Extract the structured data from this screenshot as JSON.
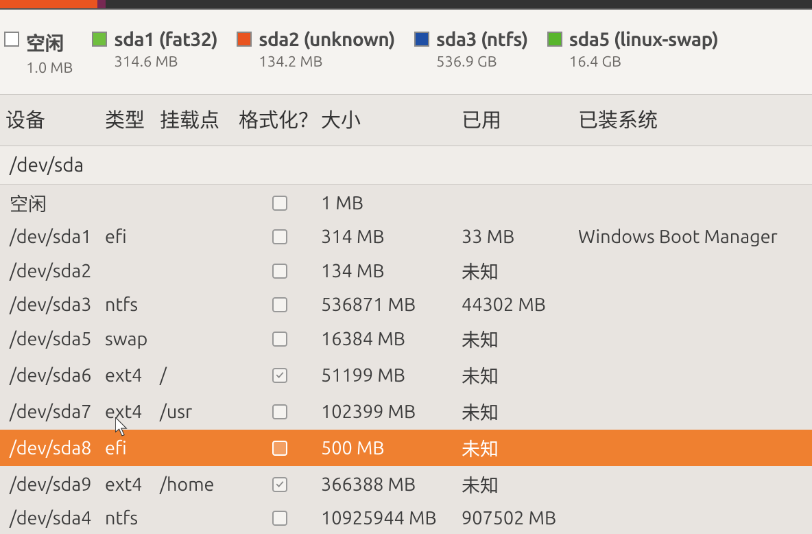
{
  "legend": {
    "free": {
      "label": "空闲",
      "size": "1.0 MB",
      "color": "#ffffff"
    },
    "items": [
      {
        "label": "sda1 (fat32)",
        "size": "314.6 MB",
        "color": "#6fbf3e"
      },
      {
        "label": "sda2 (unknown)",
        "size": "134.2 MB",
        "color": "#e95420"
      },
      {
        "label": "sda3 (ntfs)",
        "size": "536.9 GB",
        "color": "#1f4fa5"
      },
      {
        "label": "sda5 (linux-swap)",
        "size": "16.4 GB",
        "color": "#58b52c"
      }
    ]
  },
  "headers": {
    "device": "设备",
    "type": "类型",
    "mount": "挂载点",
    "format": "格式化？",
    "size": "大小",
    "used": "已用",
    "system": "已装系统"
  },
  "disk": "/dev/sda",
  "rows": [
    {
      "device": "空闲",
      "type": "",
      "mount": "",
      "format": "unchecked",
      "size": "1 MB",
      "used": "",
      "system": ""
    },
    {
      "device": "/dev/sda1",
      "type": "efi",
      "mount": "",
      "format": "unchecked",
      "size": "314 MB",
      "used": "33 MB",
      "system": "Windows Boot Manager"
    },
    {
      "device": "/dev/sda2",
      "type": "",
      "mount": "",
      "format": "unchecked",
      "size": "134 MB",
      "used": "未知",
      "system": ""
    },
    {
      "device": "/dev/sda3",
      "type": "ntfs",
      "mount": "",
      "format": "unchecked",
      "size": "536871 MB",
      "used": "44302 MB",
      "system": ""
    },
    {
      "device": "/dev/sda5",
      "type": "swap",
      "mount": "",
      "format": "unchecked",
      "size": "16384 MB",
      "used": "未知",
      "system": ""
    },
    {
      "device": "/dev/sda6",
      "type": "ext4",
      "mount": "/",
      "format": "checked",
      "size": "51199 MB",
      "used": "未知",
      "system": ""
    },
    {
      "device": "/dev/sda7",
      "type": "ext4",
      "mount": "/usr",
      "format": "unchecked",
      "size": "102399 MB",
      "used": "未知",
      "system": ""
    },
    {
      "device": "/dev/sda8",
      "type": "efi",
      "mount": "",
      "format": "unchecked",
      "size": "500 MB",
      "used": "未知",
      "system": "",
      "selected": true
    },
    {
      "device": "/dev/sda9",
      "type": "ext4",
      "mount": "/home",
      "format": "checked",
      "size": "366388 MB",
      "used": "未知",
      "system": ""
    },
    {
      "device": "/dev/sda4",
      "type": "ntfs",
      "mount": "",
      "format": "unchecked",
      "size": "10925944 MB",
      "used": "907502 MB",
      "system": ""
    }
  ]
}
